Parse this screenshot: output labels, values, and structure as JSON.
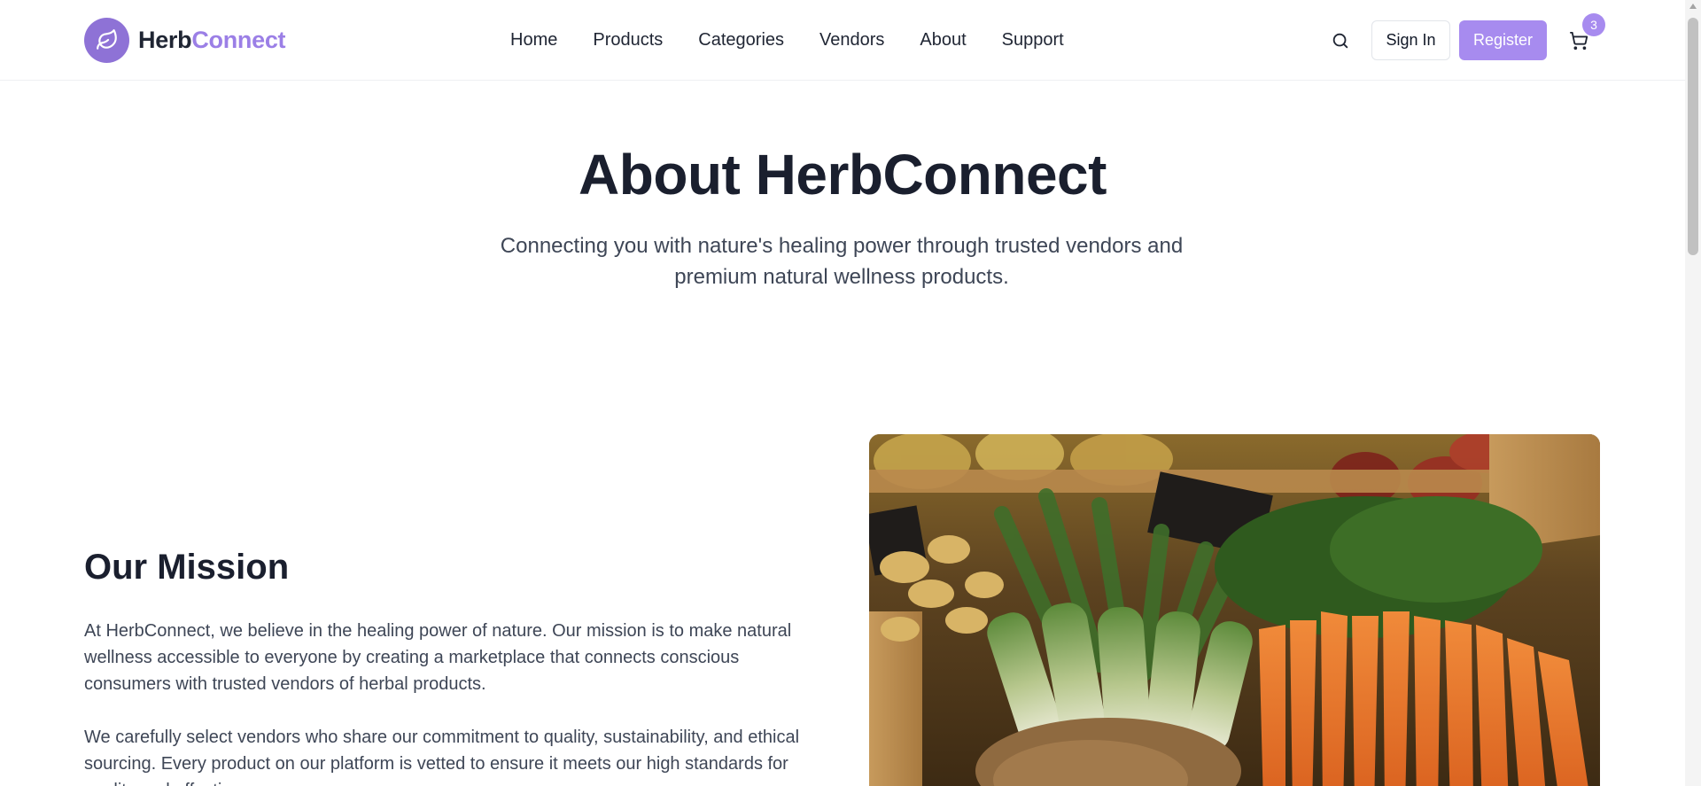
{
  "header": {
    "logo_part1": "Herb",
    "logo_part2": "Connect",
    "logo_icon": "leaf-icon",
    "nav": [
      "Home",
      "Products",
      "Categories",
      "Vendors",
      "About",
      "Support"
    ],
    "search_icon": "search-icon",
    "signin_label": "Sign In",
    "register_label": "Register",
    "cart_icon": "shopping-cart-icon",
    "cart_count": "3"
  },
  "hero": {
    "title": "About HerbConnect",
    "subtitle": "Connecting you with nature's healing power through trusted vendors and premium natural wellness products."
  },
  "mission": {
    "title": "Our Mission",
    "paragraph1": "At HerbConnect, we believe in the healing power of nature. Our mission is to make natural wellness accessible to everyone by creating a marketplace that connects conscious consumers with trusted vendors of herbal products.",
    "paragraph2": "We carefully select vendors who share our commitment to quality, sustainability, and ethical sourcing. Every product on our platform is vetted to ensure it meets our high standards for quality and effectiveness."
  },
  "colors": {
    "brand": "#a78bef",
    "brand_dark": "#8e72d6",
    "text": "#1a1f2e",
    "muted": "#3e4656"
  }
}
